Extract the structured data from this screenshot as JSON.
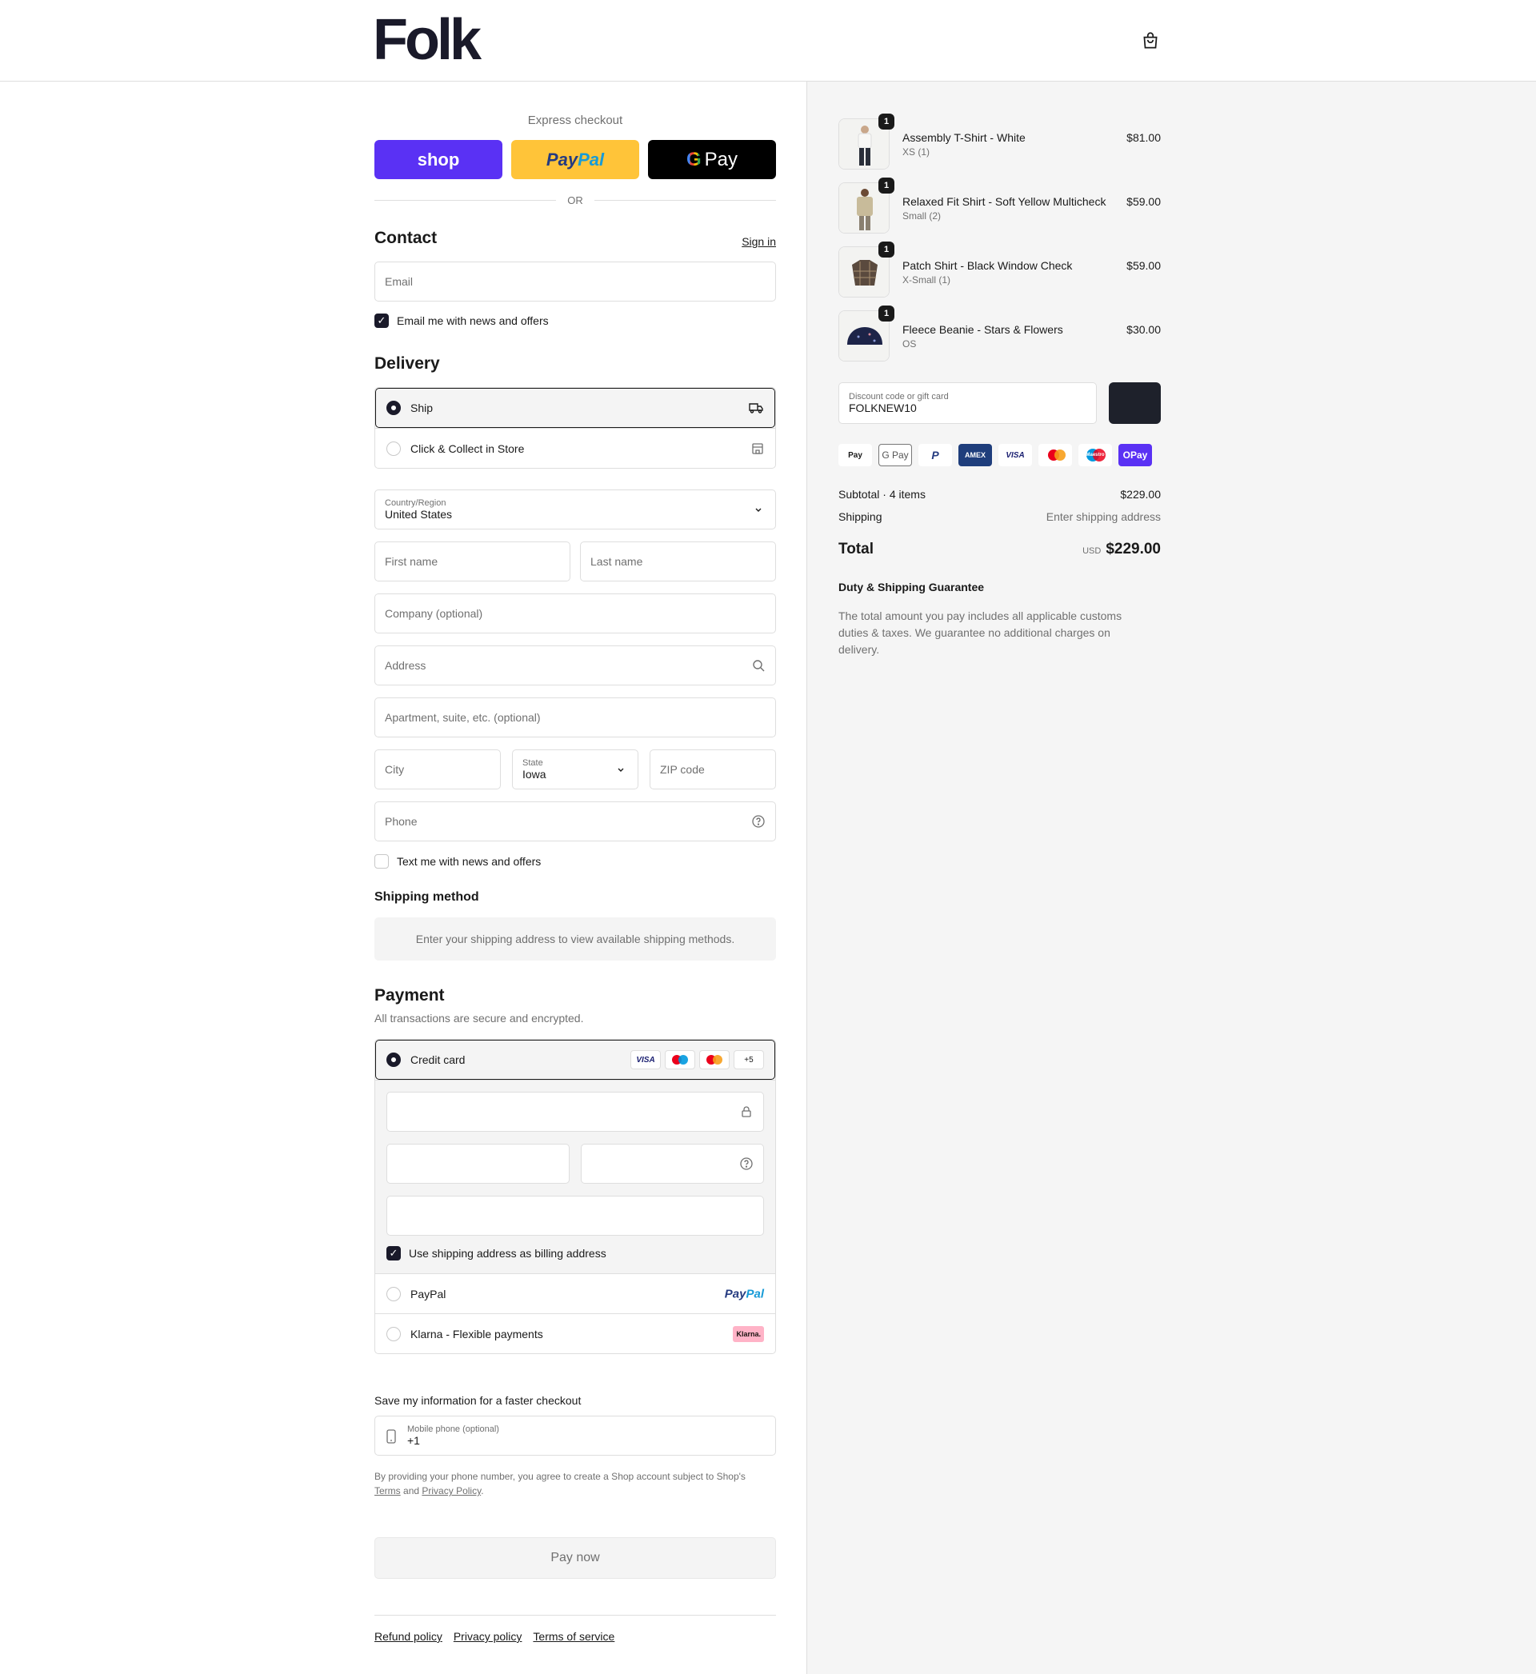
{
  "header": {
    "logo": "Folk",
    "cart_icon": "shopping-bag-icon"
  },
  "express": {
    "title": "Express checkout",
    "shop": "shop",
    "paypal_a": "Pay",
    "paypal_b": "Pal",
    "gpay_g": "G",
    "gpay": "Pay",
    "or": "OR"
  },
  "contact": {
    "title": "Contact",
    "sign_in": "Sign in",
    "email_placeholder": "Email",
    "news_label": "Email me with news and offers",
    "news_checked": true
  },
  "delivery": {
    "title": "Delivery",
    "options": [
      {
        "label": "Ship",
        "selected": true,
        "icon": "truck-icon"
      },
      {
        "label": "Click & Collect in Store",
        "selected": false,
        "icon": "store-icon"
      }
    ],
    "country_label": "Country/Region",
    "country": "United States",
    "first_name": "First name",
    "last_name": "Last name",
    "company": "Company (optional)",
    "address": "Address",
    "apartment": "Apartment, suite, etc. (optional)",
    "city": "City",
    "state_label": "State",
    "state": "Iowa",
    "zip": "ZIP code",
    "phone": "Phone",
    "text_label": "Text me with news and offers"
  },
  "shipping_method": {
    "title": "Shipping method",
    "message": "Enter your shipping address to view available shipping methods."
  },
  "payment": {
    "title": "Payment",
    "subtitle": "All transactions are secure and encrypted.",
    "credit_card": "Credit card",
    "more_cards": "+5",
    "visa": "VISA",
    "billing_label": "Use shipping address as billing address",
    "paypal": "PayPal",
    "paypal_logo_a": "Pay",
    "paypal_logo_b": "Pal",
    "klarna": "Klarna - Flexible payments",
    "klarna_logo": "Klarna."
  },
  "save": {
    "title": "Save my information for a faster checkout",
    "mobile_label": "Mobile phone (optional)",
    "mobile_value": "+1",
    "legal_pre": "By providing your phone number, you agree to create a Shop account subject to Shop's",
    "terms": "Terms",
    "and": "and",
    "privacy": "Privacy Policy",
    "dot": "."
  },
  "pay_now": "Pay now",
  "footer": {
    "links": [
      "Refund policy",
      "Privacy policy",
      "Terms of service"
    ]
  },
  "cart": {
    "items": [
      {
        "name": "Assembly T-Shirt - White",
        "variant": "XS (1)",
        "price": "$81.00",
        "qty": "1"
      },
      {
        "name": "Relaxed Fit Shirt - Soft Yellow Multicheck",
        "variant": "Small (2)",
        "price": "$59.00",
        "qty": "1"
      },
      {
        "name": "Patch Shirt - Black Window Check",
        "variant": "X-Small (1)",
        "price": "$59.00",
        "qty": "1"
      },
      {
        "name": "Fleece Beanie - Stars & Flowers",
        "variant": "OS",
        "price": "$30.00",
        "qty": "1"
      }
    ],
    "discount_label": "Discount code or gift card",
    "discount_value": "FOLKNEW10",
    "pay_logos": [
      "Pay",
      "G Pay",
      "P",
      "AMEX",
      "VISA",
      "",
      "Maestro",
      "OPay"
    ],
    "subtotal_label": "Subtotal · 4 items",
    "subtotal": "$229.00",
    "shipping_label": "Shipping",
    "shipping_value": "Enter shipping address",
    "total_label": "Total",
    "currency": "USD",
    "total": "$229.00",
    "guarantee_title": "Duty & Shipping Guarantee",
    "guarantee_text": "The total amount you pay includes all applicable customs duties & taxes. We guarantee no additional charges on delivery."
  },
  "colors": {
    "shop": "#5a31f4",
    "paypal": "#ffc439",
    "dark": "#1a1a2a",
    "panel": "#f5f5f5"
  }
}
